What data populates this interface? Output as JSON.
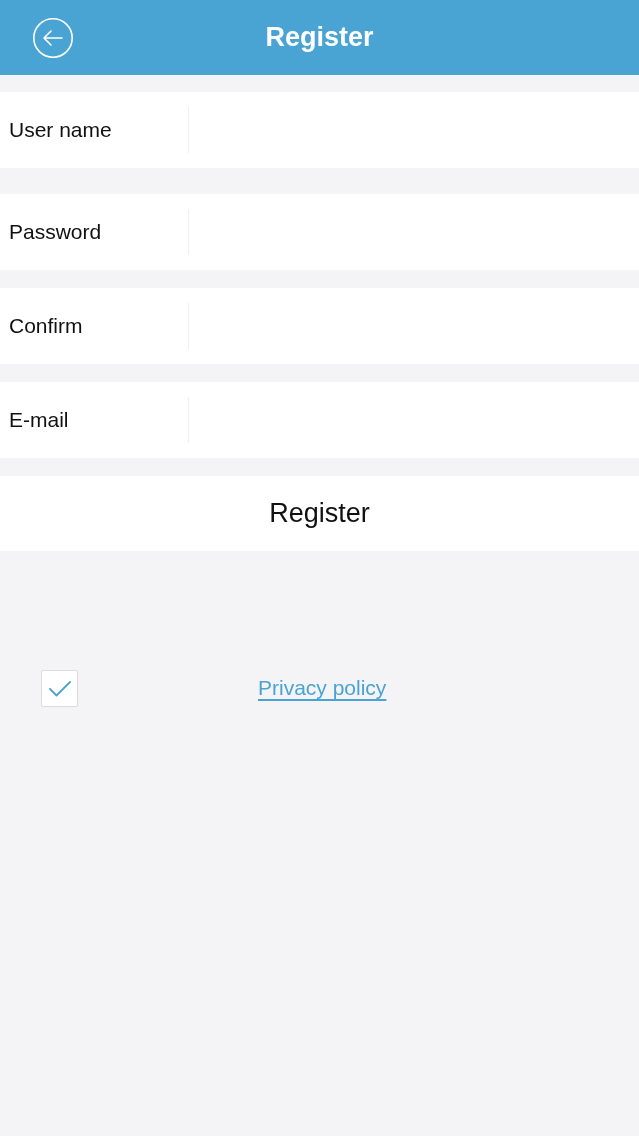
{
  "header": {
    "title": "Register"
  },
  "fields": [
    {
      "label": "User name"
    },
    {
      "label": "Password"
    },
    {
      "label": "Confirm"
    },
    {
      "label": "E-mail"
    }
  ],
  "register_button": {
    "label": "Register"
  },
  "agreement": {
    "checked": true,
    "link": "Privacy policy"
  }
}
